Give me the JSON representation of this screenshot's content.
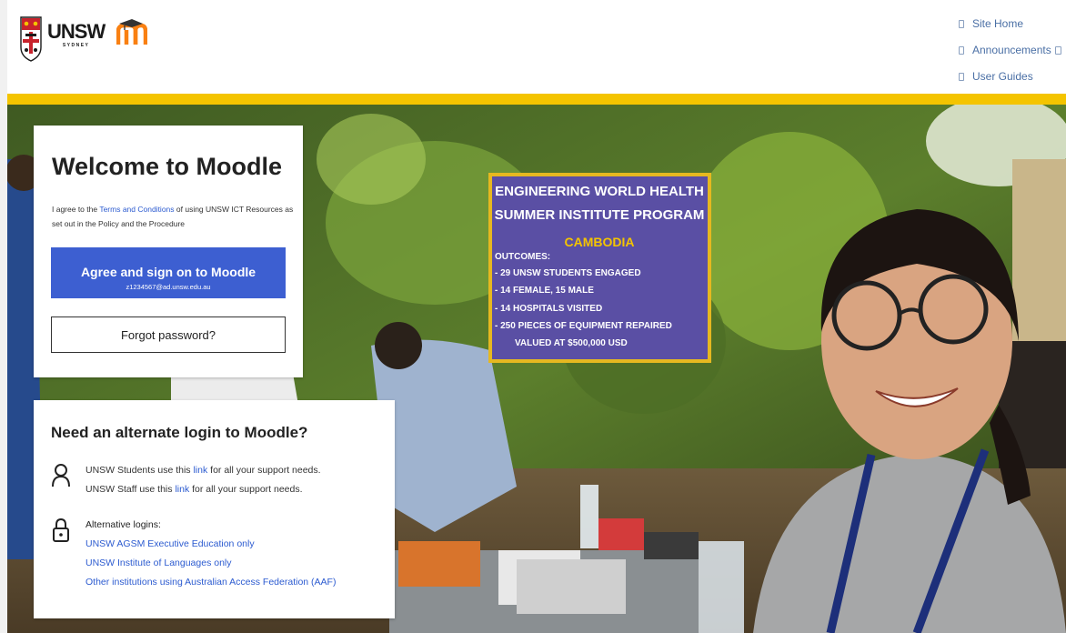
{
  "header": {
    "university_name": "UNSW",
    "university_city": "SYDNEY",
    "nav": [
      {
        "label": "Site Home"
      },
      {
        "label": "Announcements"
      },
      {
        "label": "User Guides"
      }
    ]
  },
  "colors": {
    "accent_yellow": "#f4c400",
    "primary_button": "#3d5fd1",
    "link": "#2c5bd0",
    "sign_background": "#5a4fa4",
    "sign_border": "#e6b820"
  },
  "login": {
    "title": "Welcome to Moodle",
    "agree_prefix": "I agree to the ",
    "terms_link": "Terms and Conditions",
    "agree_suffix": " of using UNSW ICT Resources as set out in the Policy and the Procedure",
    "agree_button": "Agree and sign on to Moodle",
    "account": "z1234567@ad.unsw.edu.au",
    "forgot_button": "Forgot password?"
  },
  "alternate": {
    "title": "Need an alternate login to Moodle?",
    "students_prefix": "UNSW Students use this ",
    "students_link": "link",
    "students_suffix": " for all your support needs.",
    "staff_prefix": "UNSW Staff use this ",
    "staff_link": "link",
    "staff_suffix": " for all your support needs.",
    "alt_heading": "Alternative logins:",
    "alt_links": [
      {
        "label": "UNSW AGSM Executive Education only"
      },
      {
        "label": "UNSW Institute of Languages only"
      },
      {
        "label": "Other institutions using Australian Access Federation (AAF)"
      }
    ]
  },
  "hero_sign": {
    "title_line1": "ENGINEERING WORLD HEALTH",
    "title_line2": "SUMMER INSTITUTE PROGRAM",
    "country": "CAMBODIA",
    "outcomes_label": "OUTCOMES:",
    "outcomes": [
      "- 29 UNSW STUDENTS ENGAGED",
      "- 14 FEMALE, 15 MALE",
      "- 14 HOSPITALS VISITED",
      "- 250 PIECES OF EQUIPMENT REPAIRED"
    ],
    "outcome_value": "VALUED AT $500,000 USD"
  },
  "icons": {
    "logo": "unsw-crest-icon",
    "moodle": "moodle-m-icon",
    "user": "user-icon",
    "lock": "lock-icon"
  }
}
